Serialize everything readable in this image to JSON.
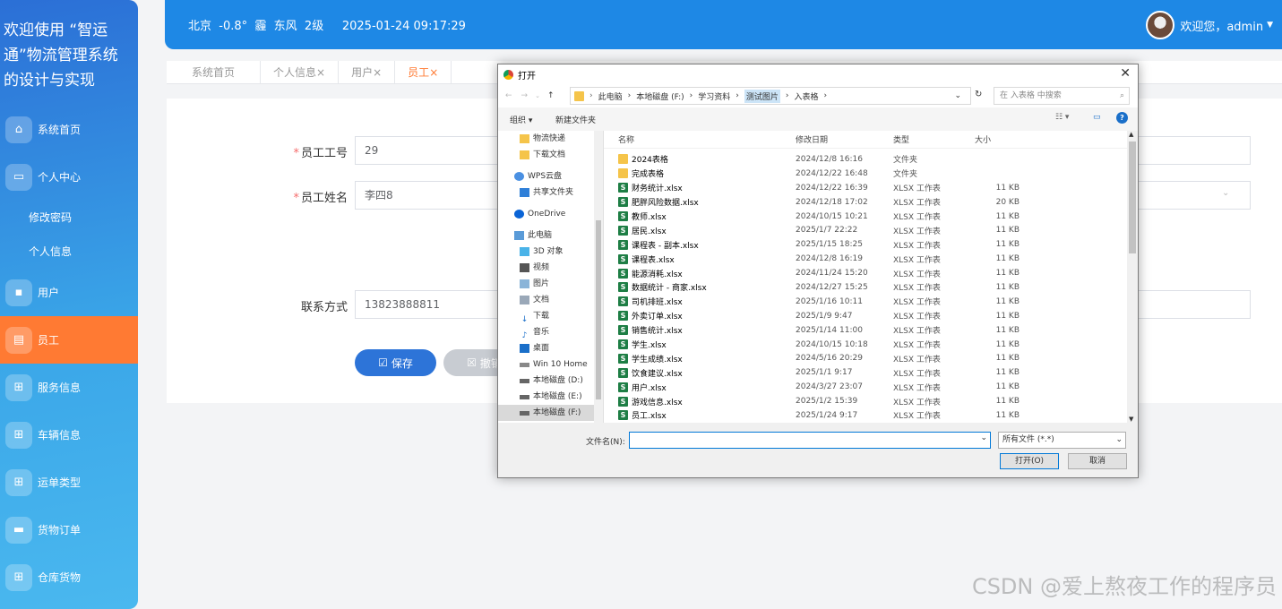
{
  "sidebar": {
    "title": "欢迎使用 “智运通”物流管理系统的设计与实现",
    "items": [
      {
        "label": "系统首页",
        "icon": "home-icon"
      },
      {
        "label": "个人中心",
        "icon": "user-center-icon"
      },
      {
        "label": "修改密码"
      },
      {
        "label": "个人信息"
      },
      {
        "label": "用户",
        "icon": "briefcase-icon"
      },
      {
        "label": "员工",
        "icon": "clipboard-icon"
      },
      {
        "label": "服务信息",
        "icon": "grid-icon"
      },
      {
        "label": "车辆信息",
        "icon": "grid-icon"
      },
      {
        "label": "运单类型",
        "icon": "grid-icon"
      },
      {
        "label": "货物订单",
        "icon": "monitor-icon"
      },
      {
        "label": "仓库货物",
        "icon": "grid-icon"
      }
    ]
  },
  "header": {
    "weather": "北京  -0.8°  霾  东风  2级     2025-01-24 09:17:29",
    "welcome": "欢迎您，admin"
  },
  "tabs": [
    "系统首页",
    "个人信息",
    "用户",
    "员工"
  ],
  "tab_close": "×",
  "form": {
    "employee_id_label": "员工工号",
    "employee_id_value": "29",
    "employee_name_label": "员工姓名",
    "employee_name_value": "李四8",
    "contact_label": "联系方式",
    "contact_value": "13823888811",
    "required_mark": "*",
    "save_label": "保存",
    "cancel_label": "撤销"
  },
  "dialog": {
    "title": "打开",
    "breadcrumb": [
      "此电脑",
      "本地磁盘 (F:)",
      "学习资料",
      "测试图片",
      "入表格"
    ],
    "search_placeholder": "在 入表格 中搜索",
    "organize": "组织",
    "new_folder": "新建文件夹",
    "nav": [
      "物流快递",
      "下载文档",
      "WPS云盘",
      "共享文件夹",
      "OneDrive",
      "此电脑",
      "3D 对象",
      "视频",
      "图片",
      "文档",
      "下载",
      "音乐",
      "桌面",
      "Win 10 Home",
      "本地磁盘 (D:)",
      "本地磁盘 (E:)",
      "本地磁盘 (F:)"
    ],
    "columns": {
      "name": "名称",
      "date": "修改日期",
      "type": "类型",
      "size": "大小"
    },
    "files": [
      {
        "name": "2024表格",
        "date": "2024/12/8 16:16",
        "type": "文件夹",
        "size": "",
        "kind": "folder"
      },
      {
        "name": "完成表格",
        "date": "2024/12/22 16:48",
        "type": "文件夹",
        "size": "",
        "kind": "folder"
      },
      {
        "name": "财务统计.xlsx",
        "date": "2024/12/22 16:39",
        "type": "XLSX 工作表",
        "size": "11 KB",
        "kind": "xlsx"
      },
      {
        "name": "肥胖风险数据.xlsx",
        "date": "2024/12/18 17:02",
        "type": "XLSX 工作表",
        "size": "20 KB",
        "kind": "xlsx"
      },
      {
        "name": "教师.xlsx",
        "date": "2024/10/15 10:21",
        "type": "XLSX 工作表",
        "size": "11 KB",
        "kind": "xlsx"
      },
      {
        "name": "居民.xlsx",
        "date": "2025/1/7 22:22",
        "type": "XLSX 工作表",
        "size": "11 KB",
        "kind": "xlsx"
      },
      {
        "name": "课程表 - 副本.xlsx",
        "date": "2025/1/15 18:25",
        "type": "XLSX 工作表",
        "size": "11 KB",
        "kind": "xlsx"
      },
      {
        "name": "课程表.xlsx",
        "date": "2024/12/8 16:19",
        "type": "XLSX 工作表",
        "size": "11 KB",
        "kind": "xlsx"
      },
      {
        "name": "能源消耗.xlsx",
        "date": "2024/11/24 15:20",
        "type": "XLSX 工作表",
        "size": "11 KB",
        "kind": "xlsx"
      },
      {
        "name": "数据统计 - 商家.xlsx",
        "date": "2024/12/27 15:25",
        "type": "XLSX 工作表",
        "size": "11 KB",
        "kind": "xlsx"
      },
      {
        "name": "司机排班.xlsx",
        "date": "2025/1/16 10:11",
        "type": "XLSX 工作表",
        "size": "11 KB",
        "kind": "xlsx"
      },
      {
        "name": "外卖订单.xlsx",
        "date": "2025/1/9 9:47",
        "type": "XLSX 工作表",
        "size": "11 KB",
        "kind": "xlsx"
      },
      {
        "name": "销售统计.xlsx",
        "date": "2025/1/14 11:00",
        "type": "XLSX 工作表",
        "size": "11 KB",
        "kind": "xlsx"
      },
      {
        "name": "学生.xlsx",
        "date": "2024/10/15 10:18",
        "type": "XLSX 工作表",
        "size": "11 KB",
        "kind": "xlsx"
      },
      {
        "name": "学生成绩.xlsx",
        "date": "2024/5/16 20:29",
        "type": "XLSX 工作表",
        "size": "11 KB",
        "kind": "xlsx"
      },
      {
        "name": "饮食建议.xlsx",
        "date": "2025/1/1 9:17",
        "type": "XLSX 工作表",
        "size": "11 KB",
        "kind": "xlsx"
      },
      {
        "name": "用户.xlsx",
        "date": "2024/3/27 23:07",
        "type": "XLSX 工作表",
        "size": "11 KB",
        "kind": "xlsx"
      },
      {
        "name": "游戏信息.xlsx",
        "date": "2025/1/2 15:39",
        "type": "XLSX 工作表",
        "size": "11 KB",
        "kind": "xlsx"
      },
      {
        "name": "员工.xlsx",
        "date": "2025/1/24 9:17",
        "type": "XLSX 工作表",
        "size": "11 KB",
        "kind": "xlsx"
      }
    ],
    "filename_label": "文件名(N):",
    "filename_value": "",
    "filter": "所有文件 (*.*)",
    "open_label": "打开(O)",
    "cancel_label": "取消"
  },
  "watermark": "CSDN @爱上熬夜工作的程序员"
}
